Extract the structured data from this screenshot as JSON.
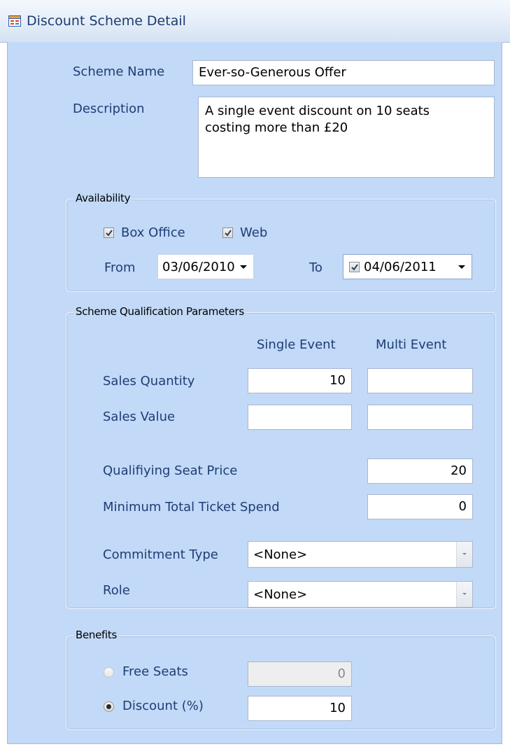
{
  "window": {
    "title": "Discount Scheme Detail",
    "icon": "form-window-icon"
  },
  "scheme": {
    "name_label": "Scheme Name",
    "name_value": "Ever-so-Generous Offer",
    "description_label": "Description",
    "description_line1": "A single event discount on 10 seats",
    "description_line2": "costing more than £20"
  },
  "availability": {
    "legend": "Availability",
    "box_office_label": "Box Office",
    "box_office_checked": true,
    "web_label": "Web",
    "web_checked": true,
    "from_label": "From",
    "from_value": "03/06/2010",
    "to_label": "To",
    "to_checked": true,
    "to_value": "04/06/2011"
  },
  "qualification": {
    "legend": "Scheme Qualification Parameters",
    "col_single": "Single Event",
    "col_multi": "Multi Event",
    "sales_quantity_label": "Sales Quantity",
    "sales_quantity_single": "10",
    "sales_quantity_multi": "",
    "sales_value_label": "Sales Value",
    "sales_value_single": "",
    "sales_value_multi": "",
    "seat_price_label": "Qualifiying Seat Price",
    "seat_price_value": "20",
    "min_spend_label": "Minimum Total Ticket Spend",
    "min_spend_value": "0",
    "commitment_label": "Commitment Type",
    "commitment_value": "<None>",
    "role_label": "Role",
    "role_value": "<None>"
  },
  "benefits": {
    "legend": "Benefits",
    "free_seats_label": "Free Seats",
    "free_seats_value": "0",
    "free_seats_selected": false,
    "discount_label": "Discount (%)",
    "discount_value": "10",
    "discount_selected": true
  }
}
